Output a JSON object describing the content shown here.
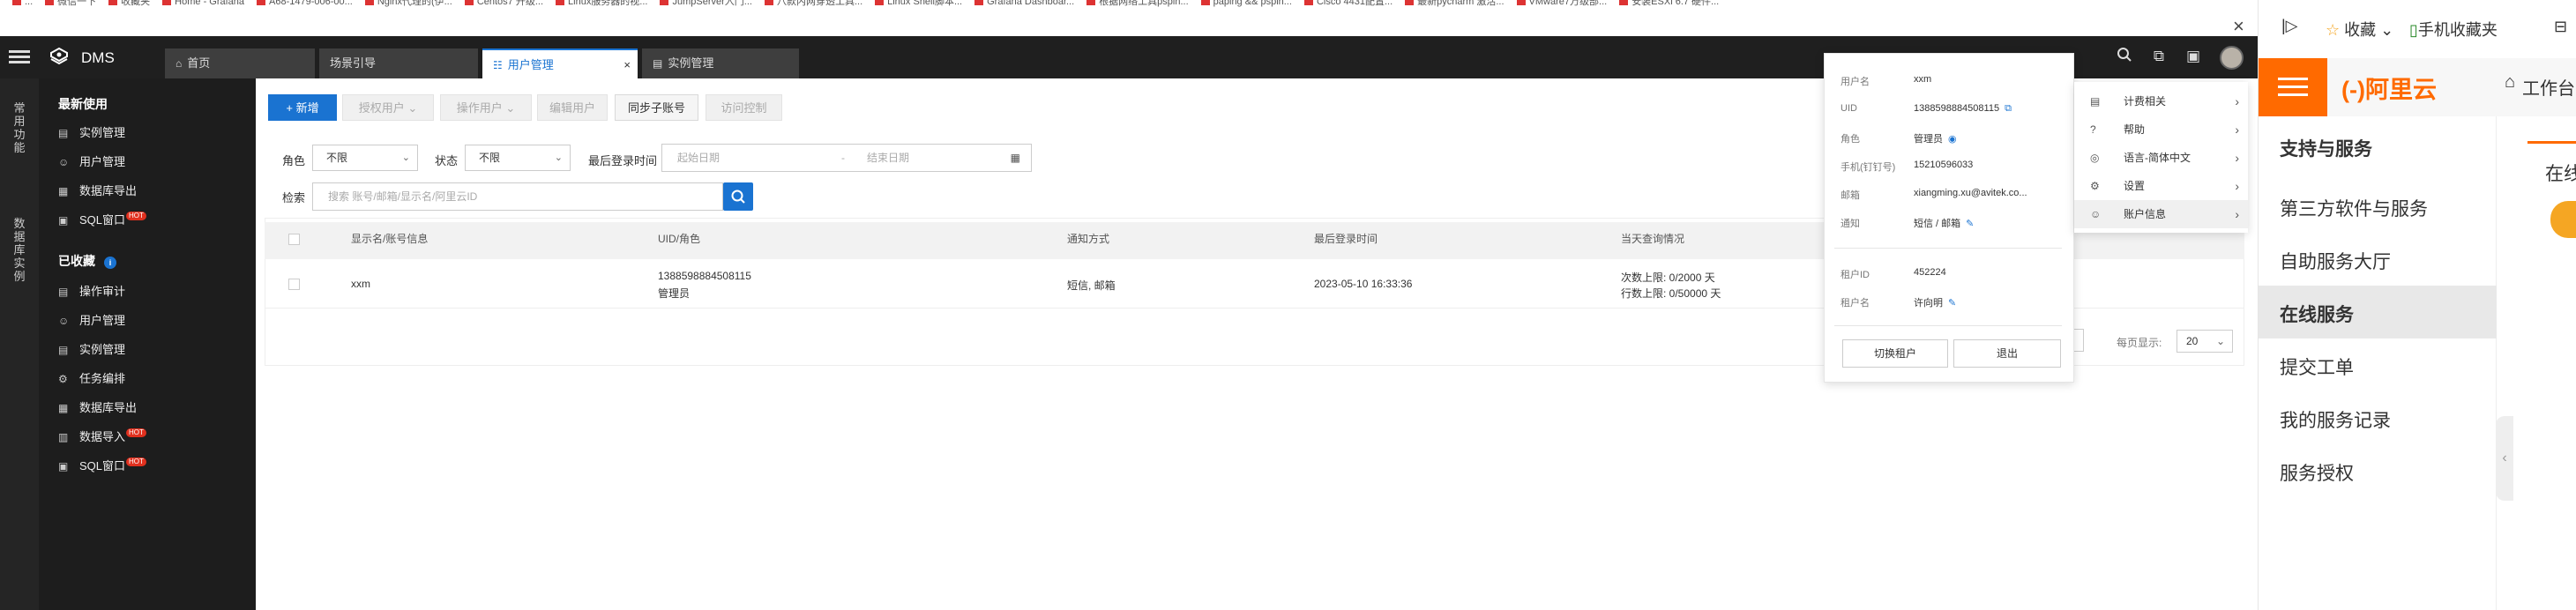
{
  "bookmarks": [
    "...",
    "微信一下",
    "收藏夹",
    "Home - Grafana",
    "A68-1479-006-00...",
    "Nginx代理的(伊...",
    "Centos7 升级...",
    "Linux服务器的视...",
    "JumpServer入门...",
    "八款内网穿透工具...",
    "Linux Shell脚本...",
    "Grafana Dashboar...",
    "根据网络工具pspin...",
    "paping && pspin...",
    "Cisco 4431配置...",
    "最新pycharm 激活...",
    "VMware7万级部...",
    "安装ESXi 6.7 硬件..."
  ],
  "app": {
    "brand": "DMS"
  },
  "tabs": [
    {
      "icon": "home-icon",
      "label": "首页"
    },
    {
      "icon": "",
      "label": "场景引导"
    },
    {
      "icon": "user-icon",
      "label": "用户管理",
      "active": true
    },
    {
      "icon": "db-icon",
      "label": "实例管理"
    }
  ],
  "rail": {
    "frequent": "常用功能",
    "instances": "数据库实例"
  },
  "nav": {
    "recent_title": "最新使用",
    "recent": [
      {
        "label": "实例管理",
        "hot": ""
      },
      {
        "label": "用户管理",
        "hot": ""
      },
      {
        "label": "数据库导出",
        "hot": ""
      },
      {
        "label": "SQL窗口",
        "hot": "HOT"
      }
    ],
    "fav_title": "已收藏",
    "fav_badge": "i",
    "favorites": [
      {
        "label": "操作审计",
        "hot": ""
      },
      {
        "label": "用户管理",
        "hot": ""
      },
      {
        "label": "实例管理",
        "hot": ""
      },
      {
        "label": "任务编排",
        "hot": ""
      },
      {
        "label": "数据库导出",
        "hot": ""
      },
      {
        "label": "数据导入",
        "hot": "HOT"
      },
      {
        "label": "SQL窗口",
        "hot": "HOT"
      }
    ]
  },
  "toolbar": {
    "add": "+ 新增",
    "grant": "授权用户",
    "operate": "操作用户",
    "edit": "编辑用户",
    "sync": "同步子账号",
    "access": "访问控制"
  },
  "filters": {
    "role_label": "角色",
    "role_value": "不限",
    "status_label": "状态",
    "status_value": "不限",
    "login_label": "最后登录时间",
    "start_ph": "起始日期",
    "date_sep": "-",
    "end_ph": "结束日期",
    "search_label": "检索",
    "search_ph": "搜索 账号/邮箱/显示名/阿里云ID"
  },
  "table": {
    "headers": [
      "显示名/账号信息",
      "UID/角色",
      "通知方式",
      "最后登录时间",
      "当天查询情况"
    ],
    "rows": [
      {
        "name": "xxm",
        "uid": "1388598884508115",
        "role": "管理员",
        "notify": "短信, 邮箱",
        "last_login": "2023-05-10 16:33:36",
        "quota1": "次数上限: 0/2000 天",
        "quota2": "行数上限: 0/50000 天"
      }
    ]
  },
  "pagination": {
    "label": "每页显示:",
    "size": "20"
  },
  "account": {
    "fields": [
      {
        "k": "用户名",
        "v": "xxm"
      },
      {
        "k": "UID",
        "v": "1388598884508115"
      },
      {
        "k": "角色",
        "v": "管理员"
      },
      {
        "k": "手机(钉钉号)",
        "v": "15210596033"
      },
      {
        "k": "邮箱",
        "v": "xiangming.xu@avitek.co..."
      },
      {
        "k": "通知",
        "v": "短信 / 邮箱"
      }
    ],
    "tenant": [
      {
        "k": "租户ID",
        "v": "452224"
      },
      {
        "k": "租户名",
        "v": "许向明"
      }
    ],
    "switch_btn": "切换租户",
    "logout_btn": "退出"
  },
  "user_menu": [
    {
      "icon": "calc-icon",
      "label": "计费相关"
    },
    {
      "icon": "help-icon",
      "label": "帮助"
    },
    {
      "icon": "globe-icon",
      "label": "语言-简体中文"
    },
    {
      "icon": "gear-icon",
      "label": "设置"
    },
    {
      "icon": "user-icon",
      "label": "账户信息",
      "active": true
    }
  ],
  "browser_side": {
    "favorites": "收藏",
    "mobile_fav": "手机收藏夹",
    "logo": "(-)阿里云",
    "workbench": "工作台",
    "section": "支持与服务",
    "items": [
      "第三方软件与服务",
      "自助服务大厅",
      "在线服务",
      "提交工单",
      "我的服务记录",
      "服务授权"
    ],
    "active_item": "在线服务",
    "right_tab": "在线"
  },
  "colors": {
    "accent": "#1a73d1",
    "ali_orange": "#ff6a00",
    "hot": "#e0301e"
  }
}
